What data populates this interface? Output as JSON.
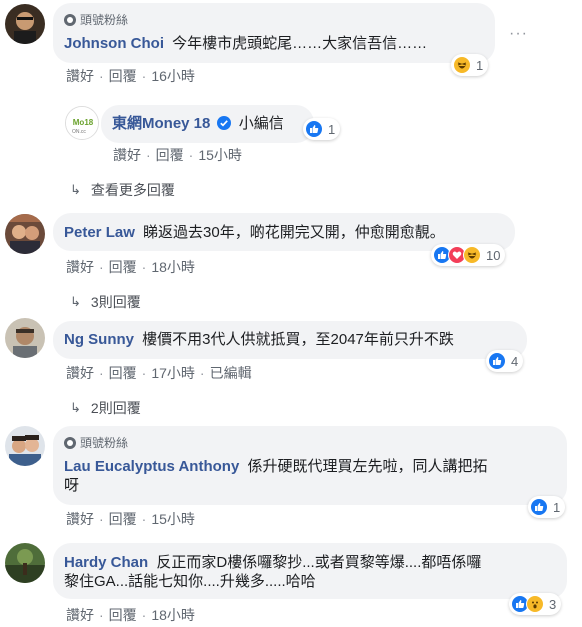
{
  "comments": [
    {
      "badge": "頭號粉絲",
      "name": "Johnson Choi",
      "text_lines": [
        "今年樓市虎頭蛇尾……大家信吾信……"
      ],
      "like": "讚好",
      "reply": "回覆",
      "time": "16小時",
      "reactions": [
        "haha-icon"
      ],
      "reaction_count": "1",
      "more_options": "···"
    },
    {
      "name": "東網Money 18",
      "text_lines": [
        "小編信"
      ],
      "like": "讚好",
      "reply": "回覆",
      "time": "15小時",
      "reactions": [
        "like-icon"
      ],
      "reaction_count": "1",
      "avatar_text": "ON.cc"
    },
    {
      "name": "Peter Law",
      "text_lines": [
        "睇返過去30年，啲花開完又開，仲愈開愈靚。"
      ],
      "like": "讚好",
      "reply": "回覆",
      "time": "18小時",
      "reactions": [
        "like-icon",
        "love-icon",
        "haha-icon"
      ],
      "reaction_count": "10",
      "replies_toggle": "3則回覆"
    },
    {
      "name": "Ng Sunny",
      "text_lines": [
        "樓價不用3代人供就抵買，至2047年前只升不跌"
      ],
      "like": "讚好",
      "reply": "回覆",
      "time": "17小時",
      "edited": "已編輯",
      "reactions": [
        "like-icon"
      ],
      "reaction_count": "4",
      "replies_toggle": "2則回覆"
    },
    {
      "badge": "頭號粉絲",
      "name": "Lau Eucalyptus Anthony",
      "text_lines": [
        "係升硬既代理買左先啦，同人講把拓",
        "呀"
      ],
      "like": "讚好",
      "reply": "回覆",
      "time": "15小時",
      "reactions": [
        "like-icon"
      ],
      "reaction_count": "1"
    },
    {
      "name": "Hardy Chan",
      "text_lines": [
        "反正而家D樓係囉黎抄...或者買黎等爆....都唔係囉",
        "黎住GA...話能七知你....升幾多.....哈哈"
      ],
      "like": "讚好",
      "reply": "回覆",
      "time": "18小時",
      "reactions": [
        "like-icon",
        "wow-icon"
      ],
      "reaction_count": "3"
    }
  ],
  "view_more_replies": "查看更多回覆",
  "colors": {
    "name": "#385898",
    "bubble": "#f2f3f5",
    "meta": "#606770",
    "like": "#1877f2",
    "love": "#f33e58",
    "haha": "#f7b928",
    "verified": "#1877f2"
  }
}
